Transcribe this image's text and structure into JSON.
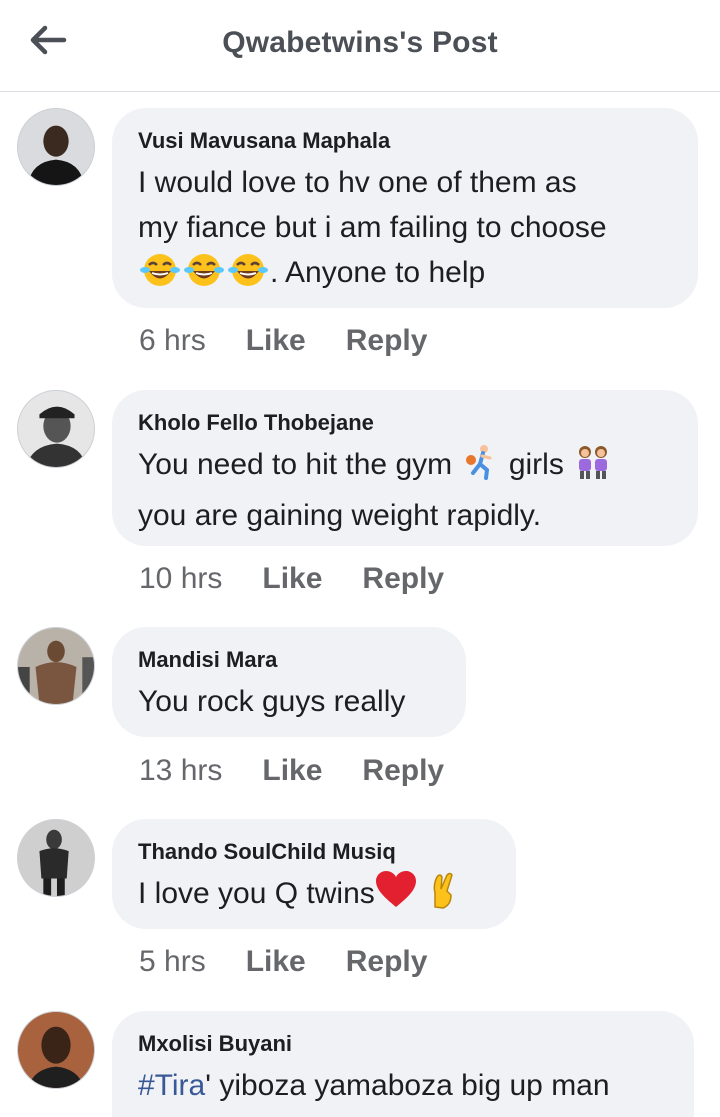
{
  "header": {
    "title": "Qwabetwins's Post",
    "back_icon": "arrow-left-icon"
  },
  "comments": [
    {
      "author": "Vusi Mavusana Maphala",
      "text_line1": "I would love to hv one of them as",
      "text_line2": "my fiance but i am failing to choose",
      "text_line3_suffix": ". Anyone to help",
      "emojis": [
        "tears-of-joy-emoji",
        "tears-of-joy-emoji",
        "tears-of-joy-emoji"
      ],
      "time": "6 hrs",
      "like": "Like",
      "reply": "Reply"
    },
    {
      "author": "Kholo Fello Thobejane",
      "text_part1": "You need to hit the gym",
      "text_part2": "girls",
      "text_line2": "you are gaining weight rapidly.",
      "emojis": [
        "basketball-player-emoji",
        "two-women-emoji"
      ],
      "time": "10 hrs",
      "like": "Like",
      "reply": "Reply"
    },
    {
      "author": "Mandisi Mara",
      "text": "You rock guys really",
      "time": "13 hrs",
      "like": "Like",
      "reply": "Reply"
    },
    {
      "author": "Thando SoulChild Musiq",
      "text": "I love you Q twins",
      "emojis": [
        "red-heart-emoji",
        "crossed-fingers-emoji"
      ],
      "time": "5 hrs",
      "like": "Like",
      "reply": "Reply"
    },
    {
      "author": "Mxolisi Buyani",
      "hashtag": "#Tira",
      "text": "' yiboza yamaboza big up man"
    }
  ]
}
